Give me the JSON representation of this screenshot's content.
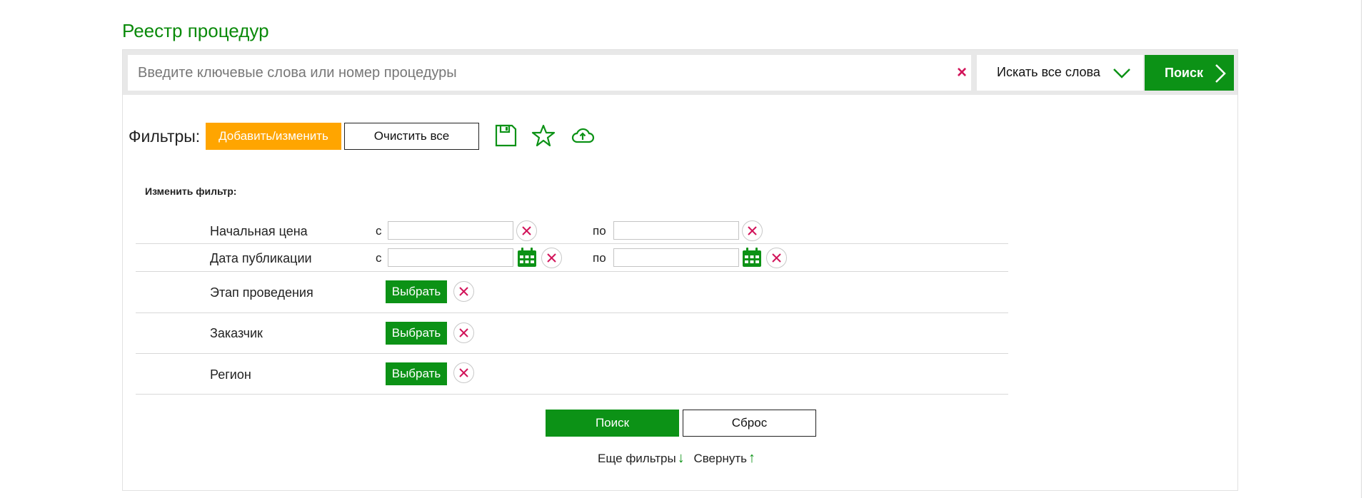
{
  "page": {
    "title": "Реестр процедур"
  },
  "search": {
    "placeholder": "Введите ключевые слова или номер процедуры",
    "value": "",
    "clear_icon": "close-icon",
    "mode_label": "Искать все слова",
    "mode_icon": "chevron-down-icon",
    "button_label": "Поиск",
    "button_icon": "chevron-right-icon"
  },
  "filters_toolbar": {
    "label": "Фильтры:",
    "add_label": "Добавить/изменить",
    "clear_all_label": "Очистить все",
    "icons": [
      "save-icon",
      "star-icon",
      "cloud-upload-icon"
    ]
  },
  "edit_filter": {
    "label": "Изменить фильтр:",
    "rows": [
      {
        "label": "Начальная цена",
        "from": "с",
        "to": "по",
        "from_value": "",
        "to_value": ""
      },
      {
        "label": "Дата публикации",
        "from": "с",
        "to": "по",
        "from_value": "",
        "to_value": ""
      },
      {
        "label": "Этап проведения",
        "button": "Выбрать"
      },
      {
        "label": "Заказчик",
        "button": "Выбрать"
      },
      {
        "label": "Регион",
        "button": "Выбрать"
      }
    ]
  },
  "actions": {
    "search_label": "Поиск",
    "reset_label": "Сброс",
    "more_filters_label": "Еще фильтры",
    "collapse_label": "Свернуть"
  },
  "colors": {
    "green": "#0c9216",
    "orange": "#ffa500",
    "red": "#d2145a"
  }
}
